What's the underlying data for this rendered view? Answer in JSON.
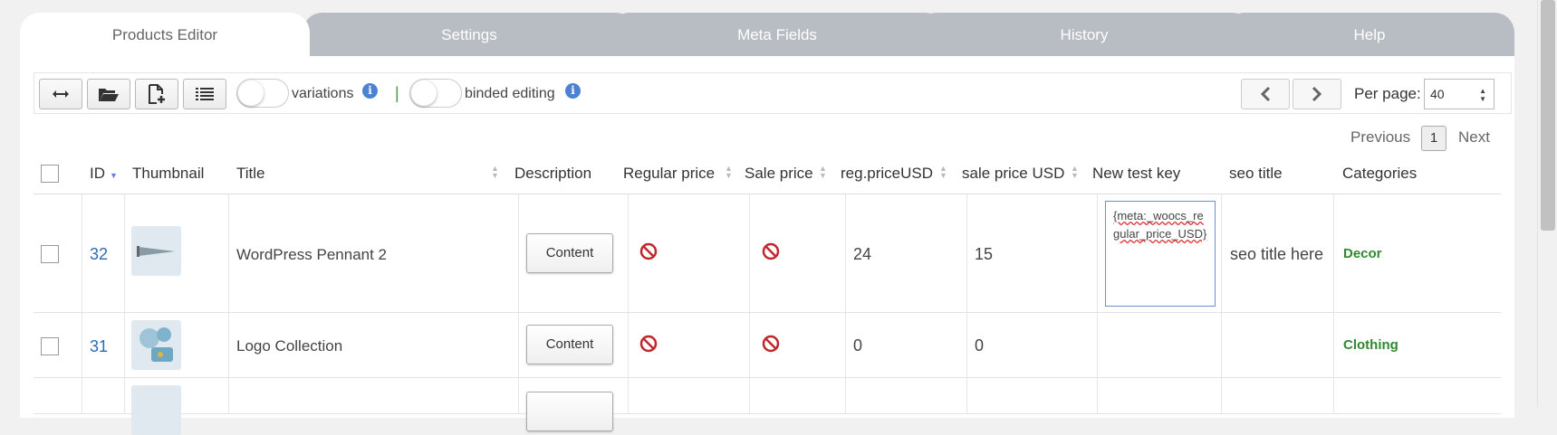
{
  "tabs": [
    {
      "label": "Products Editor",
      "active": true
    },
    {
      "label": "Settings"
    },
    {
      "label": "Meta Fields"
    },
    {
      "label": "History"
    },
    {
      "label": "Help"
    }
  ],
  "toolbar": {
    "buttons": [
      {
        "icon": "expand-horizontal-icon"
      },
      {
        "icon": "folder-open-icon"
      },
      {
        "icon": "add-document-icon"
      },
      {
        "icon": "list-icon"
      }
    ],
    "variations_label": "variations",
    "binded_editing_label": "binded editing",
    "separator": "|",
    "per_page_label": "Per page:",
    "per_page_value": "40"
  },
  "pagination": {
    "previous": "Previous",
    "current": "1",
    "next": "Next"
  },
  "columns": {
    "id": "ID",
    "thumbnail": "Thumbnail",
    "title": "Title",
    "description": "Description",
    "regular_price": "Regular price",
    "sale_price": "Sale price",
    "reg_price_usd": "reg.priceUSD",
    "sale_price_usd": "sale price USD",
    "new_test_key": "New test key",
    "seo_title": "seo title",
    "categories": "Categories"
  },
  "rows": [
    {
      "id": "32",
      "title": "WordPress Pennant 2",
      "description_button": "Content",
      "reg_price_usd": "24",
      "sale_price_usd": "15",
      "new_test_key": "{meta:_woocs_regular_price_USD}",
      "seo_title": "seo title here",
      "category": "Decor"
    },
    {
      "id": "31",
      "title": "Logo Collection",
      "description_button": "Content",
      "reg_price_usd": "0",
      "sale_price_usd": "0",
      "new_test_key": "",
      "seo_title": "",
      "category": "Clothing"
    }
  ],
  "colors": {
    "tab_inactive": "#b8bcc3",
    "link_blue": "#2f6bb3",
    "category_green": "#2f8a2f",
    "no_icon_red": "#c0272d"
  }
}
